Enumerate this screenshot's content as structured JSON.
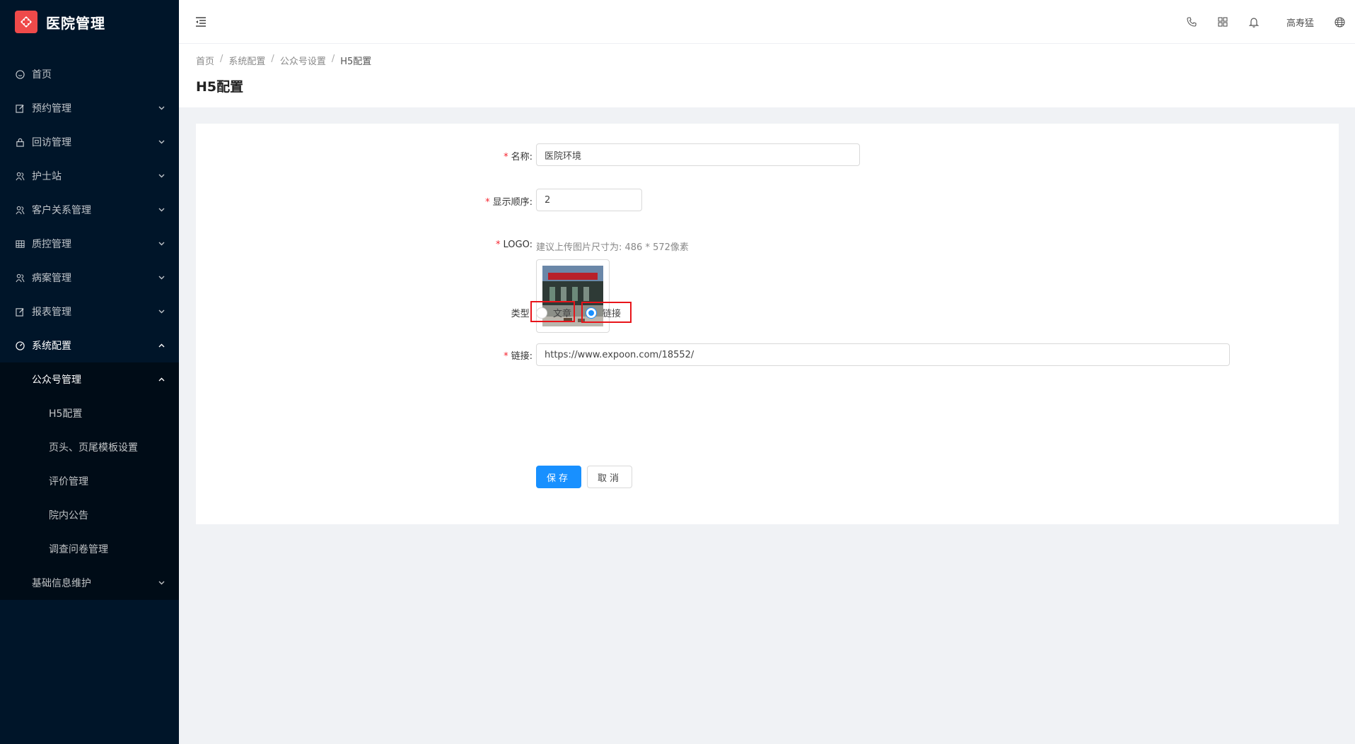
{
  "app": {
    "title": "医院管理"
  },
  "sidebar": {
    "items": [
      {
        "label": "首页",
        "icon": "dashboard-icon"
      },
      {
        "label": "预约管理",
        "icon": "edit-icon"
      },
      {
        "label": "回访管理",
        "icon": "lock-icon"
      },
      {
        "label": "护士站",
        "icon": "users-icon"
      },
      {
        "label": "客户关系管理",
        "icon": "users-icon"
      },
      {
        "label": "质控管理",
        "icon": "table-icon"
      },
      {
        "label": "病案管理",
        "icon": "users-icon"
      },
      {
        "label": "报表管理",
        "icon": "edit-icon"
      },
      {
        "label": "系统配置",
        "icon": "dashboard-icon"
      }
    ],
    "sub": {
      "group_label": "公众号管理",
      "items": [
        "H5配置",
        "页头、页尾模板设置",
        "评价管理",
        "院内公告",
        "调查问卷管理"
      ],
      "after_label": "基础信息维护"
    }
  },
  "header": {
    "username": "高寿猛"
  },
  "breadcrumb": {
    "b0": "首页",
    "b1": "系统配置",
    "b2": "公众号设置",
    "b3": "H5配置"
  },
  "page": {
    "title": "H5配置"
  },
  "form": {
    "name_label": "名称:",
    "name_value": "医院环境",
    "order_label": "显示顺序:",
    "order_value": "2",
    "logo_label": "LOGO:",
    "logo_hint": "建议上传图片尺寸为: 486 * 572像素",
    "type_label": "类型:",
    "type_option_article": "文章",
    "type_option_link": "链接",
    "link_label": "链接:",
    "link_value": "https://www.expoon.com/18552/",
    "save_label": "保存",
    "cancel_label": "取消"
  },
  "colors": {
    "sidebar_bg": "#001529",
    "primary": "#1890ff",
    "highlight": "#e8141a",
    "required": "#f5222d"
  }
}
